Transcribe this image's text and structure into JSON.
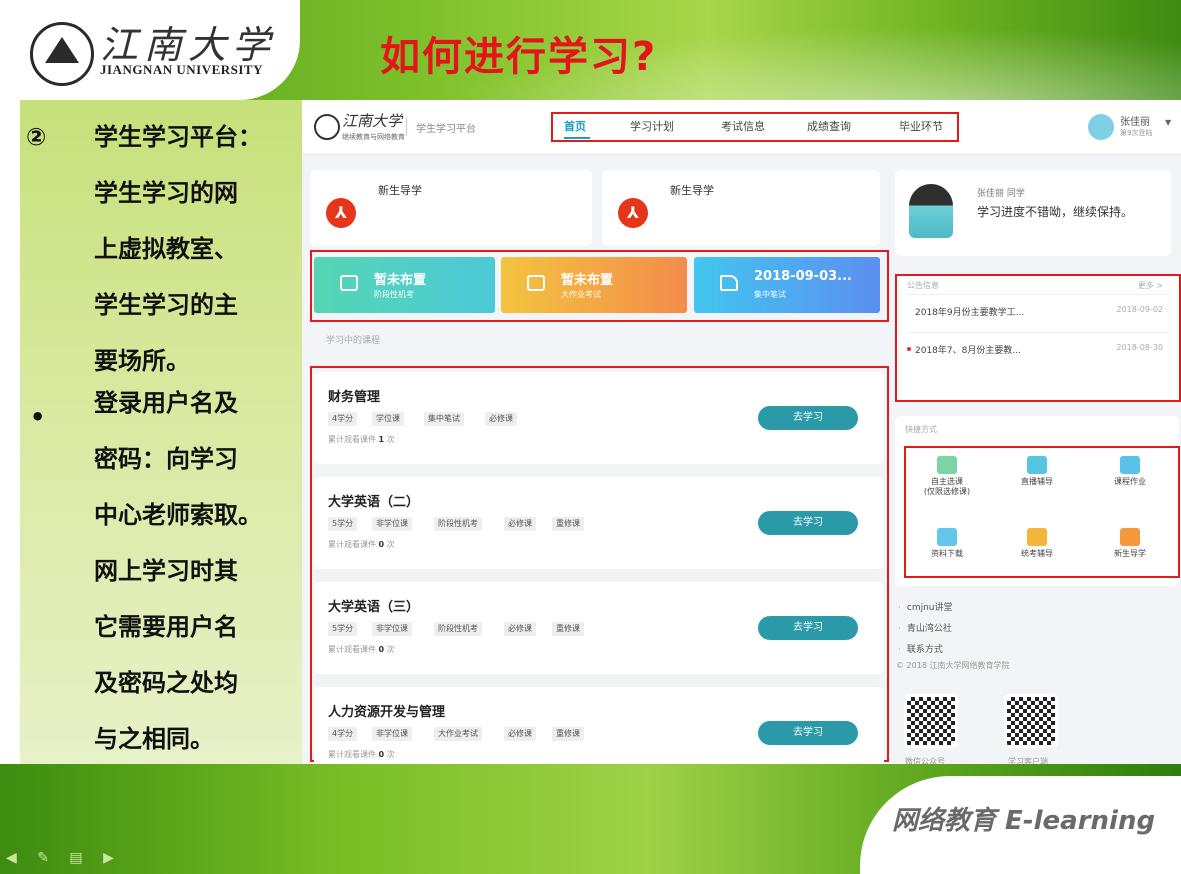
{
  "slide": {
    "logo_cn": "江南大学",
    "logo_en": "JIANGNAN UNIVERSITY",
    "title": "如何进行学习?",
    "footer_brand": "网络教育 E-learning",
    "bullets": [
      {
        "mark": "②",
        "lines": [
          "学生学习平台：",
          "学生学习的网",
          "上虚拟教室、",
          "学生学习的主",
          "要场所。"
        ]
      },
      {
        "mark": "•",
        "lines": [
          "登录用户名及",
          "密码：向学习",
          "中心老师索取。",
          "网上学习时其",
          "它需要用户名",
          "及密码之处均",
          "与之相同。"
        ]
      }
    ],
    "colors": {
      "title": "#e4141b",
      "highlight_box": "#e01b1b",
      "accent": "#1a9fc0",
      "green_band": "#7cc02b"
    }
  },
  "platform": {
    "logo_cn": "江南大学",
    "logo_sub": "继续教育与网络教育",
    "name": "学生学习平台",
    "nav": [
      "首页",
      "学习计划",
      "考试信息",
      "成绩查询",
      "毕业环节"
    ],
    "active_nav": "首页",
    "user": {
      "name": "张佳丽",
      "sub": "第9次登陆"
    },
    "guides": [
      {
        "title": "新生导学",
        "icon": "pdf-icon"
      },
      {
        "title": "新生导学",
        "icon": "pdf-icon"
      }
    ],
    "tasks": [
      {
        "main": "暂未布置",
        "sub": "阶段性机考",
        "color": "#4fd1c5"
      },
      {
        "main": "暂未布置",
        "sub": "大作业考试",
        "color": "#f6b73c"
      },
      {
        "main": "2018-09-03...",
        "sub": "集中笔试",
        "color": "#49b5f0"
      }
    ],
    "section_label": "学习中的课程",
    "courses": [
      {
        "name": "财务管理",
        "tags": [
          "4学分",
          "学位课",
          "集中笔试",
          "必修课"
        ],
        "count_prefix": "累计观看课件",
        "count": "1",
        "count_unit": "次",
        "button": "去学习"
      },
      {
        "name": "大学英语（二）",
        "tags": [
          "5学分",
          "非学位课",
          "阶段性机考",
          "必修课",
          "重修课"
        ],
        "count_prefix": "累计观看课件",
        "count": "0",
        "count_unit": "次",
        "button": "去学习"
      },
      {
        "name": "大学英语（三）",
        "tags": [
          "5学分",
          "非学位课",
          "阶段性机考",
          "必修课",
          "重修课"
        ],
        "count_prefix": "累计观看课件",
        "count": "0",
        "count_unit": "次",
        "button": "去学习"
      },
      {
        "name": "人力资源开发与管理",
        "tags": [
          "4学分",
          "非学位课",
          "大作业考试",
          "必修课",
          "重修课"
        ],
        "count_prefix": "累计观看课件",
        "count": "0",
        "count_unit": "次",
        "button": "去学习"
      }
    ],
    "profile": {
      "name": "张佳丽",
      "suffix": "同学",
      "message": "学习进度不错呦，继续保持。"
    },
    "notices": {
      "head": "公告信息",
      "more": "更多 >",
      "items": [
        {
          "text": "2018年9月份主要教学工...",
          "date": "2018-09-02",
          "unread": false
        },
        {
          "text": "2018年7、8月份主要教...",
          "date": "2018-08-30",
          "unread": true
        }
      ]
    },
    "shortcuts": {
      "head": "快捷方式",
      "items": [
        {
          "label": "自主选课\n(仅限选修课)",
          "icon": "book-icon",
          "color": "#7bd3a6"
        },
        {
          "label": "直播辅导",
          "icon": "video-icon",
          "color": "#55c5e0"
        },
        {
          "label": "课程作业",
          "icon": "task-icon",
          "color": "#5bc0ea"
        },
        {
          "label": "资料下载",
          "icon": "download-icon",
          "color": "#63c6ec"
        },
        {
          "label": "统考辅导",
          "icon": "note-icon",
          "color": "#f5b53d"
        },
        {
          "label": "新生导学",
          "icon": "guide-icon",
          "color": "#f49a3a"
        }
      ]
    },
    "links": [
      "cmjnu讲堂",
      "青山湾公社",
      "联系方式"
    ],
    "copyright": "© 2018 江南大学网络教育学院",
    "qrcodes": [
      "微信公众号",
      "学习客户端"
    ]
  }
}
